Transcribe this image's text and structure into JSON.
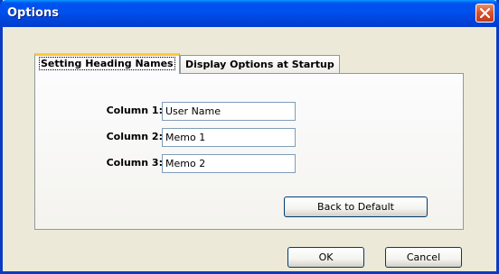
{
  "window": {
    "title": "Options"
  },
  "tabs": [
    {
      "label": "Setting Heading Names",
      "active": true
    },
    {
      "label": "Display Options at Startup",
      "active": false
    }
  ],
  "columns": [
    {
      "label": "Column 1:",
      "value": "User Name"
    },
    {
      "label": "Column 2:",
      "value": "Memo 1"
    },
    {
      "label": "Column 3:",
      "value": "Memo 2"
    }
  ],
  "buttons": {
    "back_to_default": "Back to Default",
    "ok": "OK",
    "cancel": "Cancel"
  },
  "colors": {
    "titlebar": "#0050ee",
    "close": "#d8502c",
    "background": "#ece9d8",
    "active_tab_highlight": "#ffc83c"
  }
}
